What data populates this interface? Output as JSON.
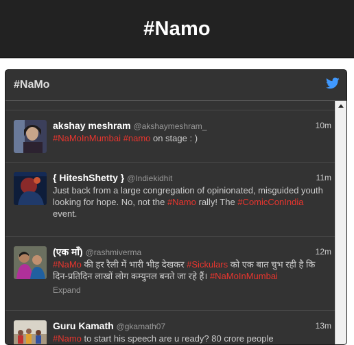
{
  "page": {
    "heading": "#Namo"
  },
  "widget": {
    "title": "#NaMo",
    "bird_icon": "twitter-bird-icon",
    "colors": {
      "accent": "#4099ff",
      "hashtag": "#e8352e",
      "background": "#333333"
    }
  },
  "tweets": [
    {
      "name": "akshay meshram",
      "handle": "@akshaymeshram_",
      "time": "10m",
      "segments": [
        {
          "text": "#NaMoInMumbai",
          "hl": true
        },
        {
          "text": " ",
          "hl": false
        },
        {
          "text": "#namo",
          "hl": true
        },
        {
          "text": " on stage   : )",
          "hl": false
        }
      ]
    },
    {
      "name": "{ HiteshShetty }",
      "handle": "@Indiekidhit",
      "time": "11m",
      "segments": [
        {
          "text": "Just back from a large congregation of opinionated, misguided youth looking for hope. No, not the ",
          "hl": false
        },
        {
          "text": "#Namo",
          "hl": true
        },
        {
          "text": " rally! The  ",
          "hl": false
        },
        {
          "text": "#ComicConIndia",
          "hl": true
        },
        {
          "text": " event.",
          "hl": false
        }
      ]
    },
    {
      "name": "(एक माँ)",
      "handle": "@rashmiverma",
      "time": "12m",
      "segments": [
        {
          "text": "#NaMo",
          "hl": true
        },
        {
          "text": " की हर रैली में भारी भीड़ देखकर  ",
          "hl": false
        },
        {
          "text": "#Sickulars",
          "hl": true
        },
        {
          "text": " को एक बात चुभ रही है कि दिन-प्रतिदिन लाखों लोग कम्युनल बनते जा रहे हैं।  ",
          "hl": false
        },
        {
          "text": "#NaMoInMumbai",
          "hl": true
        }
      ],
      "expand": "Expand"
    },
    {
      "name": "Guru Kamath",
      "handle": "@gkamath07",
      "time": "13m",
      "segments": [
        {
          "text": "#Namo",
          "hl": true
        },
        {
          "text": " to start his speech are u ready?  80 crore people",
          "hl": false
        }
      ]
    }
  ]
}
